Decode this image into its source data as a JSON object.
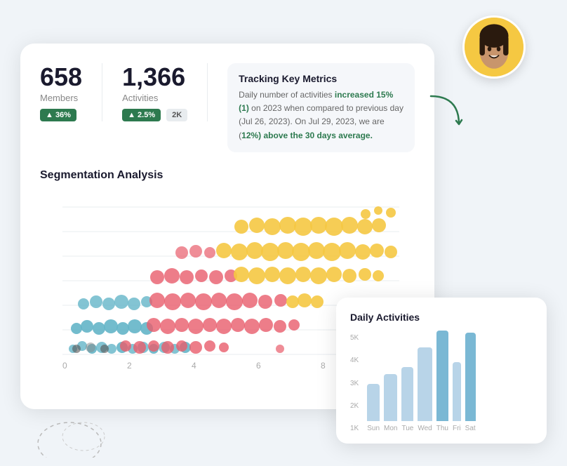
{
  "metrics": {
    "members": {
      "value": "658",
      "label": "Members",
      "badge": "▲ 36%"
    },
    "activities": {
      "value": "1,366",
      "label": "Activities",
      "badge": "▲ 2.5%",
      "extra": "2K"
    }
  },
  "tracking": {
    "title": "Tracking Key Metrics",
    "text_before": "Daily number of activities ",
    "highlight1": "increased 15% (1)",
    "text_mid": " on 2023 when compared to previous day (Jul 26, 2023). On Jul 29, 2023, we are (",
    "highlight2": "12%) above the 30 days average.",
    "text_end": ""
  },
  "segmentation": {
    "title": "Segmentation Analysis",
    "x_labels": [
      "0",
      "2",
      "4",
      "6",
      "8"
    ]
  },
  "daily": {
    "title": "Daily Activities",
    "y_labels": [
      "5K",
      "4K",
      "3K",
      "2K",
      "1K"
    ],
    "bars": [
      {
        "label": "Sun",
        "height_pct": 38
      },
      {
        "label": "Mon",
        "height_pct": 48
      },
      {
        "label": "Tue",
        "height_pct": 55
      },
      {
        "label": "Wed",
        "height_pct": 75
      },
      {
        "label": "Thu",
        "height_pct": 92
      },
      {
        "label": "Fri",
        "height_pct": 60
      },
      {
        "label": "Sat",
        "height_pct": 90
      }
    ]
  }
}
